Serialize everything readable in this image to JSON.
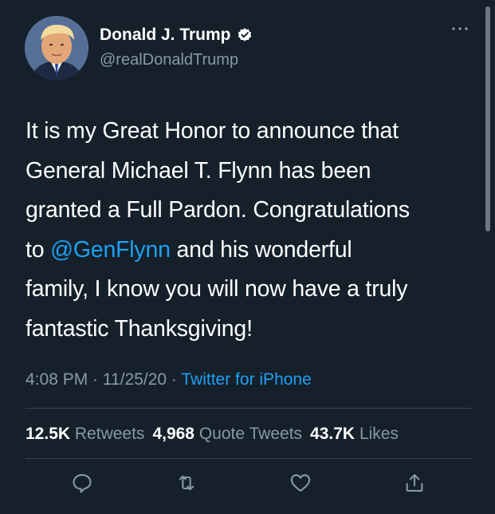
{
  "author": {
    "display_name": "Donald J. Trump",
    "handle": "@realDonaldTrump",
    "verified": true
  },
  "tweet": {
    "lines": [
      {
        "pre": "It is my Great Honor to announce that",
        "mention": "",
        "post": ""
      },
      {
        "pre": "General Michael T. Flynn has been",
        "mention": "",
        "post": ""
      },
      {
        "pre": "granted a Full Pardon. Congratulations",
        "mention": "",
        "post": ""
      },
      {
        "pre": "to ",
        "mention": "@GenFlynn",
        "post": " and his wonderful"
      },
      {
        "pre": "family, I know you will now have a truly",
        "mention": "",
        "post": ""
      },
      {
        "pre": "fantastic Thanksgiving!",
        "mention": "",
        "post": ""
      }
    ]
  },
  "meta": {
    "time": "4:08 PM",
    "separator": " · ",
    "date": "11/25/20",
    "source": "Twitter for iPhone"
  },
  "stats": {
    "retweets_count": "12.5K",
    "retweets_label": "Retweets",
    "quotes_count": "4,968",
    "quotes_label": "Quote Tweets",
    "likes_count": "43.7K",
    "likes_label": "Likes"
  },
  "icons": {
    "more": "more-icon",
    "reply": "reply-icon",
    "retweet": "retweet-icon",
    "like": "heart-icon",
    "share": "share-icon",
    "verified": "verified-badge-icon"
  },
  "colors": {
    "background": "#15202b",
    "text": "#ffffff",
    "secondary": "#8899a6",
    "accent": "#1da1f2",
    "divider": "#38444d"
  }
}
